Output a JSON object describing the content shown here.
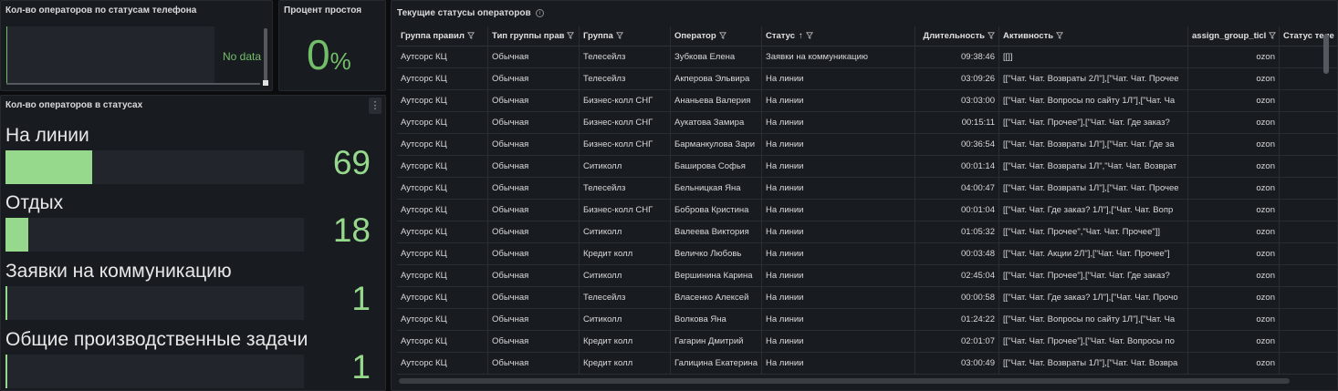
{
  "panel_phone": {
    "title": "Кол-во операторов по статусам телефона",
    "no_data": "No data"
  },
  "panel_idle": {
    "title": "Процент простоя",
    "value": "0",
    "unit": "%"
  },
  "panel_status_counts": {
    "title": "Кол-во операторов в статусах",
    "menu": "⋮",
    "items": [
      {
        "label": "На линии",
        "value": "69",
        "fill": 0.29
      },
      {
        "label": "Отдых",
        "value": "18",
        "fill": 0.075
      },
      {
        "label": "Заявки на коммуникацию",
        "value": "1",
        "fill": 0.006
      },
      {
        "label": "Общие производственные задачи",
        "value": "1",
        "fill": 0.006
      }
    ],
    "bar_color": "#96d98d"
  },
  "panel_table": {
    "title": "Текущие статусы операторов",
    "columns": [
      "Группа правил",
      "Тип группы прав",
      "Группа",
      "Оператор",
      "Статус",
      "Длительность",
      "Активность",
      "assign_group_ticl",
      "Статус теле"
    ],
    "sort_indicator": "↑",
    "rows": [
      [
        "Аутсорс КЦ",
        "Обычная",
        "Телесейлз",
        "Зубкова Елена",
        "Заявки на коммуникацию",
        "09:38:46",
        "[[]]",
        "ozon"
      ],
      [
        "Аутсорс КЦ",
        "Обычная",
        "Телесейлз",
        "Акперова Эльвира",
        "На линии",
        "03:09:26",
        "[[\"Чат. Чат. Возвраты 2Л\"],[\"Чат. Чат. Прочее",
        "ozon"
      ],
      [
        "Аутсорс КЦ",
        "Обычная",
        "Бизнес-колл СНГ",
        "Ананьева Валерия",
        "На линии",
        "03:03:00",
        "[[\"Чат. Чат. Вопросы по сайту 1Л\"],[\"Чат. Ча",
        "ozon"
      ],
      [
        "Аутсорс КЦ",
        "Обычная",
        "Бизнес-колл СНГ",
        "Аукатова Замира",
        "На линии",
        "00:15:11",
        "[[\"Чат. Чат. Прочее\"],[\"Чат. Чат. Где заказ?",
        "ozon"
      ],
      [
        "Аутсорс КЦ",
        "Обычная",
        "Бизнес-колл СНГ",
        "Барманкулова Зари",
        "На линии",
        "00:36:54",
        "[[\"Чат. Чат. Возвраты 1Л\"],[\"Чат. Чат. Где за",
        "ozon"
      ],
      [
        "Аутсорс КЦ",
        "Обычная",
        "Ситиколл",
        "Баширова Софья",
        "На линии",
        "00:01:14",
        "[[\"Чат. Чат. Возвраты 1Л\",\"Чат. Чат. Возврат",
        "ozon"
      ],
      [
        "Аутсорс КЦ",
        "Обычная",
        "Телесейлз",
        "Бельницкая Яна",
        "На линии",
        "04:00:47",
        "[[\"Чат. Чат. Возвраты 1Л\"],[\"Чат. Чат. Прочее",
        "ozon"
      ],
      [
        "Аутсорс КЦ",
        "Обычная",
        "Бизнес-колл СНГ",
        "Боброва Кристина",
        "На линии",
        "00:01:04",
        "[[\"Чат. Чат. Где заказ? 1Л\"],[\"Чат. Чат. Вопр",
        "ozon"
      ],
      [
        "Аутсорс КЦ",
        "Обычная",
        "Ситиколл",
        "Валеева Виктория",
        "На линии",
        "01:05:32",
        "[[\"Чат. Чат. Прочее\",\"Чат. Чат. Прочее\"]]",
        "ozon"
      ],
      [
        "Аутсорс КЦ",
        "Обычная",
        "Кредит колл",
        "Величко Любовь",
        "На линии",
        "00:03:48",
        "[[\"Чат. Чат. Акции 2Л\"],[\"Чат. Чат. Прочее\"]",
        "ozon"
      ],
      [
        "Аутсорс КЦ",
        "Обычная",
        "Ситиколл",
        "Вершинина Карина",
        "На линии",
        "02:45:04",
        "[[\"Чат. Чат. Прочее\"],[\"Чат. Чат. Где заказ?",
        "ozon"
      ],
      [
        "Аутсорс КЦ",
        "Обычная",
        "Телесейлз",
        "Власенко Алексей",
        "На линии",
        "00:00:58",
        "[[\"Чат. Чат. Где заказ? 1Л\"],[\"Чат. Чат. Прочо",
        "ozon"
      ],
      [
        "Аутсорс КЦ",
        "Обычная",
        "Ситиколл",
        "Волкова Яна",
        "На линии",
        "01:24:22",
        "[[\"Чат. Чат. Вопросы по сайту 1Л\"],[\"Чат. Ча",
        "ozon"
      ],
      [
        "Аутсорс КЦ",
        "Обычная",
        "Кредит колл",
        "Гагарин Дмитрий",
        "На линии",
        "02:01:07",
        "[[\"Чат. Чат. Прочее\"],[\"Чат. Чат. Вопросы по",
        "ozon"
      ],
      [
        "Аутсорс КЦ",
        "Обычная",
        "Кредит колл",
        "Галицина Екатерина",
        "На линии",
        "03:00:49",
        "[[\"Чат. Чат. Возвраты 1Л\"],[\"Чат. Чат. Возвра",
        "ozon"
      ]
    ]
  },
  "colors": {
    "accent_green": "#73bf69",
    "bar_green": "#96d98d",
    "panel_bg": "#181b1f",
    "page_bg": "#0b0c0e"
  }
}
